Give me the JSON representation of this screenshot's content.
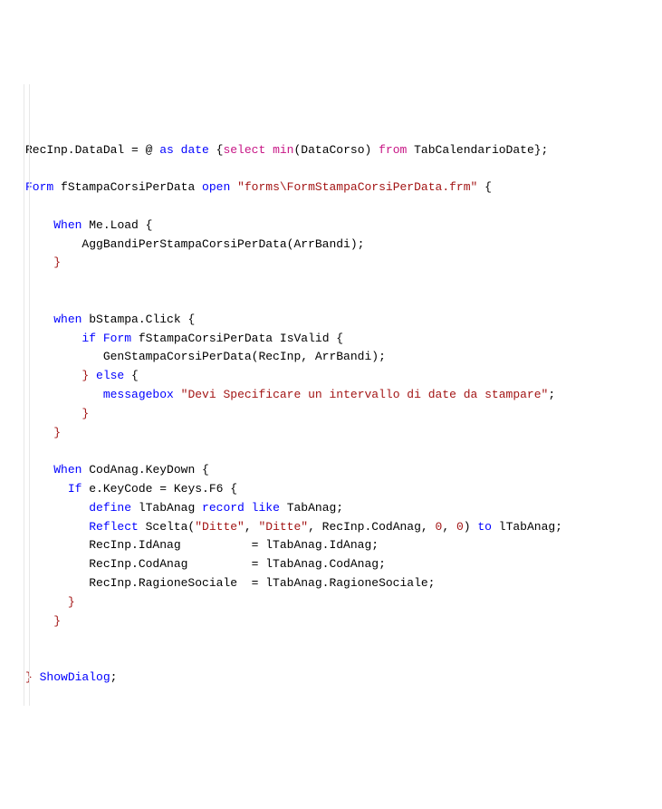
{
  "chart_data": {
    "type": "table",
    "title": "Code snippet (custom DSL/VB-like)",
    "lines": [
      "RecInp.DataDal = @ as date {select min(DataCorso) from TabCalendarioDate};",
      "",
      "Form fStampaCorsiPerData open \"forms\\FormStampaCorsiPerData.frm\" {",
      "",
      "    When Me.Load {",
      "        AggBandiPerStampaCorsiPerData(ArrBandi);",
      "    }",
      "",
      "",
      "    when bStampa.Click {",
      "        if Form fStampaCorsiPerData IsValid {",
      "           GenStampaCorsiPerData(RecInp, ArrBandi);",
      "        } else {",
      "           messagebox \"Devi Specificare un intervallo di date da stampare\";",
      "        }",
      "    }",
      "",
      "    When CodAnag.KeyDown {",
      "      If e.KeyCode = Keys.F6 {",
      "         define lTabAnag record like TabAnag;",
      "         Reflect Scelta(\"Ditte\", \"Ditte\", RecInp.CodAnag, 0, 0) to lTabAnag;",
      "         RecInp.IdAnag          = lTabAnag.IdAnag;",
      "         RecInp.CodAnag         = lTabAnag.CodAnag;",
      "         RecInp.RagioneSociale  = lTabAnag.RagioneSociale;",
      "      }",
      "    }",
      "",
      "",
      "} ShowDialog;"
    ]
  },
  "code": {
    "l1_a": "RecInp.DataDal = @ ",
    "l1_b": "as date",
    "l1_c": " {",
    "l1_d": "select",
    "l1_e": " ",
    "l1_f": "min",
    "l1_g": "(DataCorso) ",
    "l1_h": "from",
    "l1_i": " TabCalendarioDate};",
    "l3_a": "Form",
    "l3_b": " fStampaCorsiPerData ",
    "l3_c": "open",
    "l3_d": " ",
    "l3_e": "\"forms\\FormStampaCorsiPerData.frm\"",
    "l3_f": " {",
    "l5_a": "When",
    "l5_b": " Me.Load {",
    "l6_a": "        AggBandiPerStampaCorsiPerData(ArrBandi);",
    "l7_a": "}",
    "l10_a": "when",
    "l10_b": " bStampa.Click {",
    "l11_a": "if",
    "l11_b": " ",
    "l11_c": "Form",
    "l11_d": " fStampaCorsiPerData IsValid {",
    "l12_a": "           GenStampaCorsiPerData(RecInp, ArrBandi);",
    "l13_a": "} ",
    "l13_b": "else",
    "l13_c": " {",
    "l14_a": "messagebox",
    "l14_b": " ",
    "l14_c": "\"Devi Specificare un intervallo di date da stampare\"",
    "l14_d": ";",
    "l15_a": "}",
    "l16_a": "}",
    "l18_a": "When",
    "l18_b": " CodAnag.KeyDown {",
    "l19_a": "If",
    "l19_b": " e.KeyCode = Keys.F6 {",
    "l20_a": "define",
    "l20_b": " lTabAnag ",
    "l20_c": "record",
    "l20_d": " ",
    "l20_e": "like",
    "l20_f": " TabAnag;",
    "l21_a": "Reflect",
    "l21_b": " Scelta(",
    "l21_c": "\"Ditte\"",
    "l21_d": ", ",
    "l21_e": "\"Ditte\"",
    "l21_f": ", RecInp.CodAnag, ",
    "l21_g": "0",
    "l21_h": ", ",
    "l21_i": "0",
    "l21_j": ") ",
    "l21_k": "to",
    "l21_l": " lTabAnag;",
    "l22_a": "         RecInp.IdAnag          = lTabAnag.IdAnag;",
    "l23_a": "         RecInp.CodAnag         = lTabAnag.CodAnag;",
    "l24_a": "         RecInp.RagioneSociale  = lTabAnag.RagioneSociale;",
    "l25_a": "}",
    "l26_a": "}",
    "l29_a": "} ",
    "l29_b": "ShowDialog",
    "l29_c": ";"
  }
}
